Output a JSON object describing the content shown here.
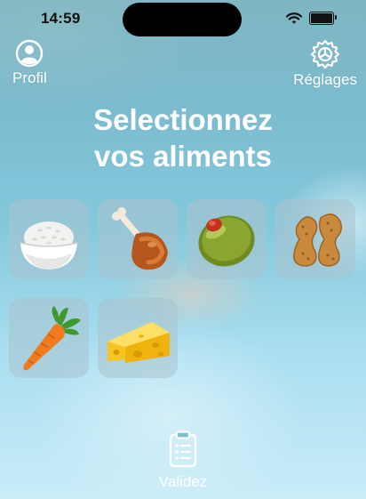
{
  "status_bar": {
    "time": "14:59"
  },
  "header": {
    "profile_label": "Profil",
    "settings_label": "Réglages"
  },
  "title_lines": [
    "Selectionnez",
    "vos aliments"
  ],
  "foods": [
    "rice-bowl",
    "poultry-leg",
    "olive",
    "peanuts",
    "carrot",
    "cheese"
  ],
  "footer": {
    "validate_label": "Validez"
  },
  "colors": {
    "text": "#ffffff",
    "tile": "#aac3cd"
  }
}
